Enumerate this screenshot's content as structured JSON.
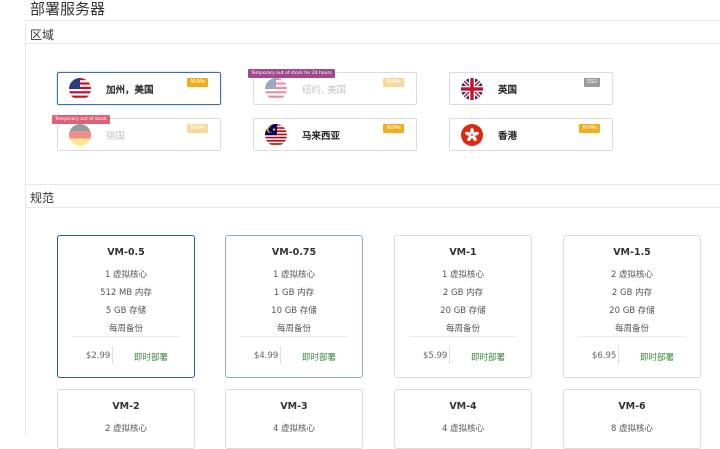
{
  "page": {
    "title": "部署服务器"
  },
  "sections": {
    "region": "区域",
    "spec": "规范"
  },
  "regions": [
    {
      "name": "加州，美国",
      "flag": "us-flag-icon",
      "disk": "NVMe",
      "stock_tag": "",
      "selected": true
    },
    {
      "name": "纽约, 美国",
      "flag": "us-flag-icon",
      "disk": "NVMe",
      "stock_tag": "Temporary out of stock for 24 hours",
      "selected": false
    },
    {
      "name": "英国",
      "flag": "uk-flag-icon",
      "disk": "SSD",
      "stock_tag": "",
      "selected": false
    },
    {
      "name": "德国",
      "flag": "de-flag-icon",
      "disk": "NVMe",
      "stock_tag": "Temporary out of stock",
      "selected": false
    },
    {
      "name": "马来西亚",
      "flag": "my-flag-icon",
      "disk": "NVMe",
      "stock_tag": "",
      "selected": false
    },
    {
      "name": "香港",
      "flag": "hk-flag-icon",
      "disk": "NVMe",
      "stock_tag": "",
      "selected": false
    }
  ],
  "plans": [
    {
      "name": "VM-0.5",
      "cpu": "1 虚拟核心",
      "ram": "512 MB 内存",
      "disk": "5 GB 存储",
      "backup": "每周备份",
      "price": "$2.99",
      "deploy": "即时部署"
    },
    {
      "name": "VM-0.75",
      "cpu": "1 虚拟核心",
      "ram": "1 GB 内存",
      "disk": "10 GB 存储",
      "backup": "每周备份",
      "price": "$4.99",
      "deploy": "即时部署"
    },
    {
      "name": "VM-1",
      "cpu": "1 虚拟核心",
      "ram": "2 GB 内存",
      "disk": "20 GB 存储",
      "backup": "每周备份",
      "price": "$5.99",
      "deploy": "即时部署"
    },
    {
      "name": "VM-1.5",
      "cpu": "2 虚拟核心",
      "ram": "2 GB 内存",
      "disk": "20 GB 存储",
      "backup": "每周备份",
      "price": "$6.95",
      "deploy": "即时部署"
    },
    {
      "name": "VM-2",
      "cpu": "2 虚拟核心"
    },
    {
      "name": "VM-3",
      "cpu": "4 虚拟核心"
    },
    {
      "name": "VM-4",
      "cpu": "4 虚拟核心"
    },
    {
      "name": "VM-6",
      "cpu": "8 虚拟核心"
    }
  ]
}
